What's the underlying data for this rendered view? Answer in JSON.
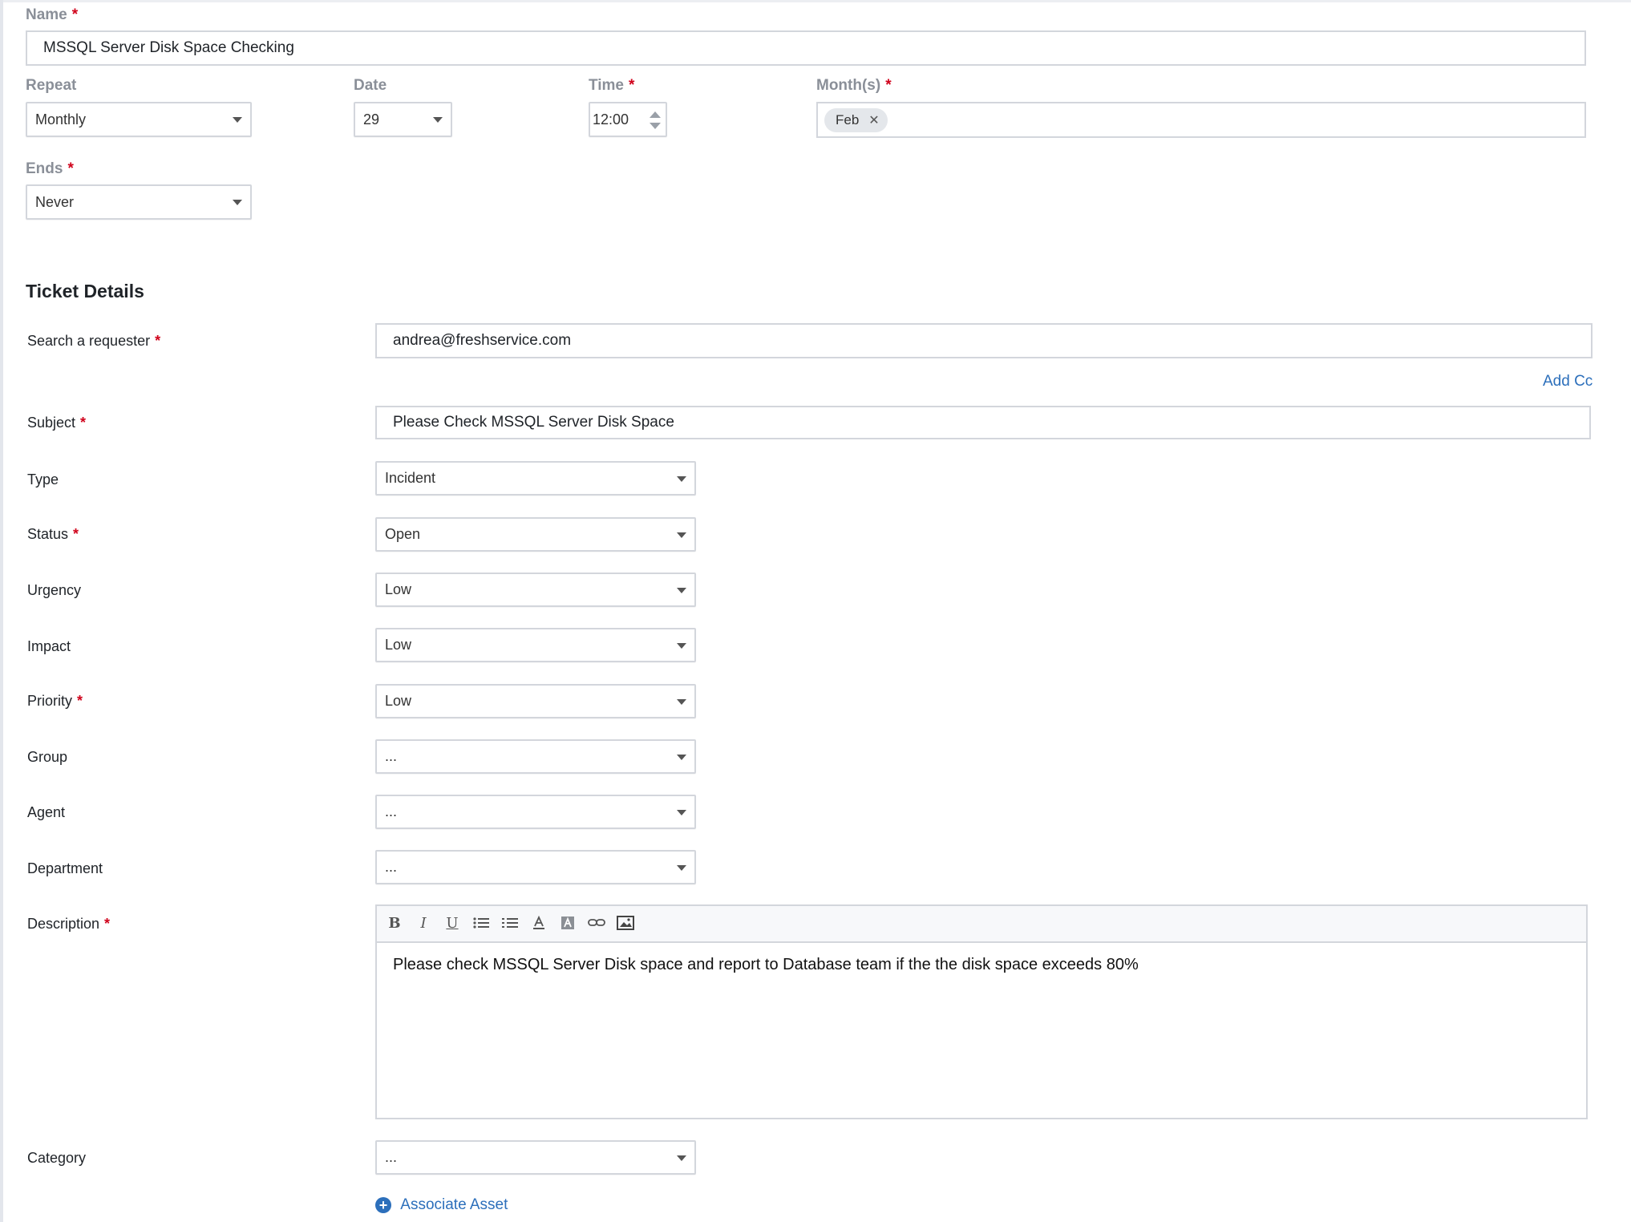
{
  "schedule": {
    "name_label": "Name",
    "name_value": "MSSQL Server Disk Space Checking",
    "repeat_label": "Repeat",
    "repeat_value": "Monthly",
    "date_label": "Date",
    "date_value": "29",
    "time_label": "Time",
    "time_value": "12:00",
    "months_label": "Month(s)",
    "months_tags": [
      "Feb"
    ],
    "ends_label": "Ends",
    "ends_value": "Never",
    "required_mark": "*"
  },
  "ticket": {
    "section_title": "Ticket Details",
    "requester_label": "Search a requester",
    "requester_value": "andrea@freshservice.com",
    "add_cc": "Add Cc",
    "subject_label": "Subject",
    "subject_value": "Please Check MSSQL Server Disk Space",
    "type_label": "Type",
    "type_value": "Incident",
    "status_label": "Status",
    "status_value": "Open",
    "urgency_label": "Urgency",
    "urgency_value": "Low",
    "impact_label": "Impact",
    "impact_value": "Low",
    "priority_label": "Priority",
    "priority_value": "Low",
    "group_label": "Group",
    "group_value": "...",
    "agent_label": "Agent",
    "agent_value": "...",
    "department_label": "Department",
    "department_value": "...",
    "description_label": "Description",
    "description_value": "Please check MSSQL Server Disk space and report to Database team if the the disk space exceeds 80%",
    "category_label": "Category",
    "category_value": "...",
    "associate_asset": "Associate Asset"
  },
  "editor_toolbar": {
    "bold": "B",
    "italic": "I",
    "underline": "U",
    "icons": [
      "bullet-list-icon",
      "numbered-list-icon",
      "font-color-icon",
      "background-color-icon",
      "link-icon",
      "image-icon"
    ]
  },
  "colors": {
    "required": "#d0021b",
    "link": "#2c6fbb",
    "border": "#d3d6dc",
    "label_muted": "#8a8f98"
  }
}
